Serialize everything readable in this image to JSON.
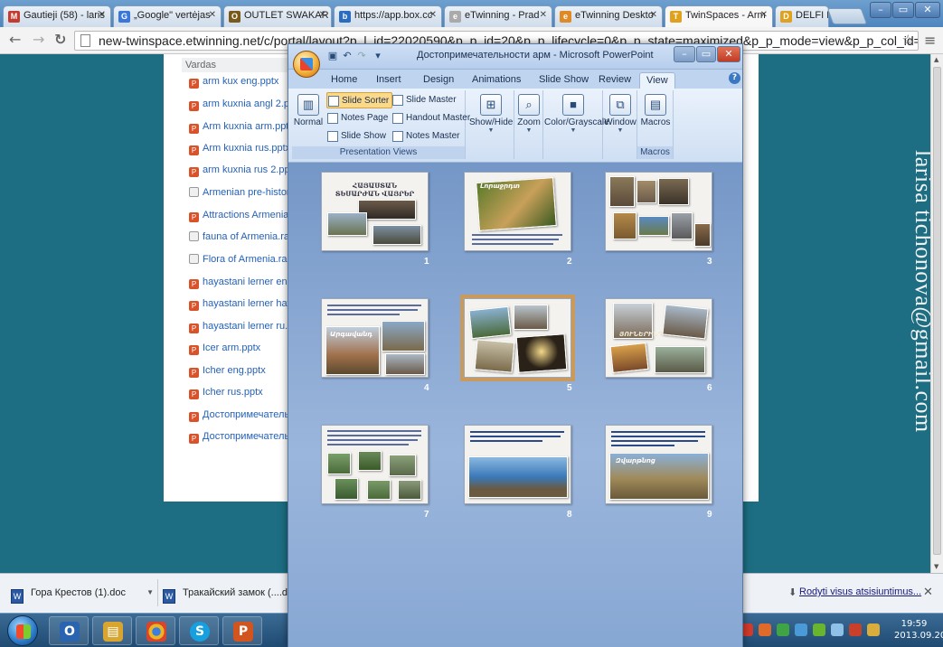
{
  "browser": {
    "tabs": [
      {
        "label": "Gautieji (58) - laris",
        "icon_letter": "M",
        "icon_color": "#c33c2f"
      },
      {
        "label": "„Google\" vertėjas",
        "icon_letter": "G",
        "icon_color": "#3a77d8"
      },
      {
        "label": "OUTLET SWAKAR",
        "icon_letter": "O",
        "icon_color": "#7a5a1a"
      },
      {
        "label": "https://app.box.cc",
        "icon_letter": "b",
        "icon_color": "#2a6cc0"
      },
      {
        "label": "eTwinning - Prad",
        "icon_letter": "e",
        "icon_color": "#aaaaaa"
      },
      {
        "label": "eTwinning Deskto",
        "icon_letter": "e",
        "icon_color": "#e08a26"
      },
      {
        "label": "TwinSpaces - Arm",
        "icon_letter": "T",
        "icon_color": "#e0a21e"
      },
      {
        "label": "DELFI Paštas",
        "icon_letter": "D",
        "icon_color": "#e0a21e"
      }
    ],
    "url": "new-twinspace.etwinning.net/c/portal/layout?p_l_id=22020590&p_p_id=20&p_p_lifecycle=0&p_p_state=maximized&p_p_mode=view&p_p_col_id=column-1&p_p_col_p"
  },
  "page": {
    "column_header": "Vardas",
    "files": [
      {
        "name": "arm kux eng.pptx",
        "broken": false
      },
      {
        "name": "arm kuxnia angl 2.pptx",
        "broken": false
      },
      {
        "name": "Arm kuxnia arm.pptx",
        "broken": false
      },
      {
        "name": "Arm kuxnia rus.pptx",
        "broken": false
      },
      {
        "name": "arm kuxnia rus 2.pptx",
        "broken": false
      },
      {
        "name": "Armenian pre-historic",
        "broken": true
      },
      {
        "name": "Attractions Armenia.ppt",
        "broken": false
      },
      {
        "name": "fauna of Armenia.rar",
        "broken": true
      },
      {
        "name": "Flora of Armenia.rar",
        "broken": true
      },
      {
        "name": "hayastani lerner eng.p",
        "broken": false
      },
      {
        "name": "hayastani lerner hay.pp",
        "broken": false
      },
      {
        "name": "hayastani lerner ru.pptx",
        "broken": false
      },
      {
        "name": "Icer arm.pptx",
        "broken": false
      },
      {
        "name": "Icher eng.pptx",
        "broken": false
      },
      {
        "name": "Icher rus.pptx",
        "broken": false
      },
      {
        "name": "Достопримечательно",
        "broken": false
      },
      {
        "name": "Достопримечательно",
        "broken": false
      }
    ],
    "watermark": "larisa tichonova@gmail.com"
  },
  "powerpoint": {
    "title": "Достопримечательности арм - Microsoft PowerPoint",
    "tabs": [
      "Home",
      "Insert",
      "Design",
      "Animations",
      "Slide Show",
      "Review",
      "View"
    ],
    "active_tab": "View",
    "groups": {
      "presentation_views": {
        "label": "Presentation Views",
        "normal": "Normal",
        "slide_sorter": "Slide Sorter",
        "notes_page": "Notes Page",
        "slide_show": "Slide Show",
        "slide_master": "Slide Master",
        "handout_master": "Handout Master",
        "notes_master": "Notes Master"
      },
      "show_hide": "Show/Hide",
      "zoom": "Zoom",
      "color_grayscale": "Color/Grayscale",
      "window": "Window",
      "macros": {
        "label": "Macros",
        "button": "Macros"
      }
    },
    "slides": [
      {
        "number": "1",
        "title": "ՀԱՅԱՍՏԱՆ ՏԵՍԱՐԺԱՆ ՎԱՅՐԵՐ"
      },
      {
        "number": "2",
        "title": "Լորաջրդտ"
      },
      {
        "number": "3",
        "title": ""
      },
      {
        "number": "4",
        "title": "Արգավանդ"
      },
      {
        "number": "5",
        "title": ""
      },
      {
        "number": "6",
        "title": "ՅՈՒՆԵՐԻՆԴ"
      },
      {
        "number": "7",
        "title": ""
      },
      {
        "number": "8",
        "title": ""
      },
      {
        "number": "9",
        "title": "Զվարթնոց"
      }
    ],
    "selected_slide": "5"
  },
  "downloads": {
    "items": [
      "Гора Крестов (1).doc",
      "Тракайский замок (....doc"
    ],
    "show_all": "Rodyti visus atsisiuntimus..."
  },
  "taskbar": {
    "language": "RU",
    "time": "19:59",
    "date": "2013.09.20"
  }
}
